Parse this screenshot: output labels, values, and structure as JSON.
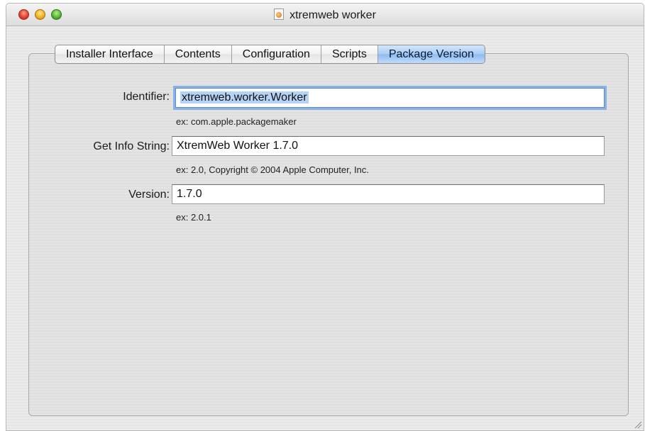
{
  "window": {
    "title": "xtremweb worker"
  },
  "tabs": [
    {
      "label": "Installer Interface"
    },
    {
      "label": "Contents"
    },
    {
      "label": "Configuration"
    },
    {
      "label": "Scripts"
    },
    {
      "label": "Package Version"
    }
  ],
  "selected_tab": "Package Version",
  "form": {
    "identifier": {
      "label": "Identifier:",
      "value": "xtremweb.worker.Worker",
      "hint": "ex: com.apple.packagemaker"
    },
    "get_info_string": {
      "label": "Get Info String:",
      "value": "XtremWeb Worker 1.7.0",
      "hint": "ex: 2.0, Copyright © 2004 Apple Computer, Inc."
    },
    "version": {
      "label": "Version:",
      "value": "1.7.0",
      "hint": "ex: 2.0.1"
    }
  },
  "icons": {
    "title_icon": "document-icon",
    "resize": "resize-grip-icon"
  },
  "colors": {
    "selected_tab": "#a9cdf4",
    "focus_ring": "#88b2e6",
    "close": "#e0442f",
    "minimize": "#f1b227",
    "zoom": "#5ab635"
  }
}
